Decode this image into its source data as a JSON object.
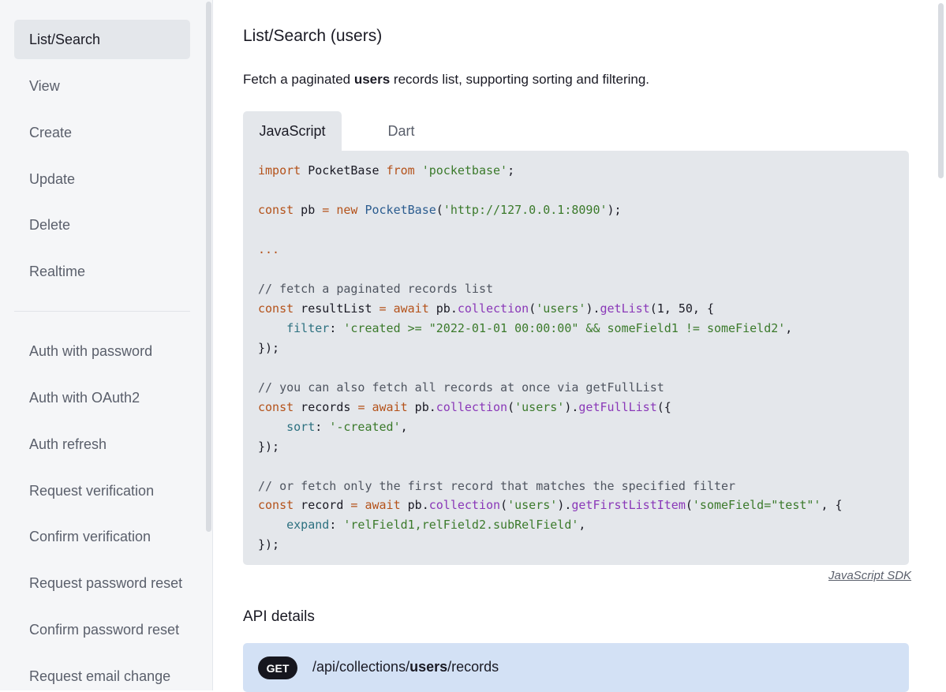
{
  "sidebar": {
    "items": [
      {
        "label": "List/Search",
        "active": true
      },
      {
        "label": "View"
      },
      {
        "label": "Create"
      },
      {
        "label": "Update"
      },
      {
        "label": "Delete"
      },
      {
        "label": "Realtime"
      },
      {
        "label": "Auth with password"
      },
      {
        "label": "Auth with OAuth2"
      },
      {
        "label": "Auth refresh"
      },
      {
        "label": "Request verification"
      },
      {
        "label": "Confirm verification"
      },
      {
        "label": "Request password reset"
      },
      {
        "label": "Confirm password reset"
      },
      {
        "label": "Request email change"
      }
    ]
  },
  "page": {
    "title": "List/Search (users)",
    "desc_prefix": "Fetch a paginated ",
    "desc_bold": "users",
    "desc_suffix": " records list, supporting sorting and filtering."
  },
  "tabs": [
    {
      "label": "JavaScript",
      "active": true
    },
    {
      "label": "Dart",
      "active": false
    }
  ],
  "code": {
    "l1_kw": "import",
    "l1_a": " PocketBase ",
    "l1_kw2": "from",
    "l1_sp": " ",
    "l1_str": "'pocketbase'",
    "l1_end": ";",
    "l2_kw": "const",
    "l2_a": " pb ",
    "l2_op": "=",
    "l2_sp": " ",
    "l2_kw2": "new",
    "l2_sp2": " ",
    "l2_cls": "PocketBase",
    "l2_p": "(",
    "l2_str": "'http://127.0.0.1:8090'",
    "l2_end": ");",
    "l3_dots": "...",
    "l4_cm": "// fetch a paginated records list",
    "l5_kw": "const",
    "l5_a": " resultList ",
    "l5_op": "=",
    "l5_sp": " ",
    "l5_kw2": "await",
    "l5_b": " pb.",
    "l5_fn": "collection",
    "l5_p": "(",
    "l5_str": "'users'",
    "l5_c": ").",
    "l5_fn2": "getList",
    "l5_d": "(1, ",
    "l5_num": "50",
    "l5_e": ", {",
    "l6_prop": "    filter",
    "l6_c": ": ",
    "l6_str": "'created >= \"2022-01-01 00:00:00\" && someField1 != someField2'",
    "l6_e": ",",
    "l7": "});",
    "l8_cm": "// you can also fetch all records at once via getFullList",
    "l9_kw": "const",
    "l9_a": " records ",
    "l9_op": "=",
    "l9_sp": " ",
    "l9_kw2": "await",
    "l9_b": " pb.",
    "l9_fn": "collection",
    "l9_p": "(",
    "l9_str": "'users'",
    "l9_c": ").",
    "l9_fn2": "getFullList",
    "l9_e": "({",
    "l10_prop": "    sort",
    "l10_c": ": ",
    "l10_str": "'-created'",
    "l10_e": ",",
    "l11": "});",
    "l12_cm": "// or fetch only the first record that matches the specified filter",
    "l13_kw": "const",
    "l13_a": " record ",
    "l13_op": "=",
    "l13_sp": " ",
    "l13_kw2": "await",
    "l13_b": " pb.",
    "l13_fn": "collection",
    "l13_p": "(",
    "l13_str": "'users'",
    "l13_c": ").",
    "l13_fn2": "getFirstListItem",
    "l13_p2": "(",
    "l13_str2": "'someField=\"test\"'",
    "l13_e": ", {",
    "l14_prop": "    expand",
    "l14_c": ": ",
    "l14_str": "'relField1,relField2.subRelField'",
    "l14_e": ",",
    "l15": "});"
  },
  "sdk_link": "JavaScript SDK",
  "api": {
    "heading": "API details",
    "method": "GET",
    "path_prefix": "/api/collections/",
    "path_bold": "users",
    "path_suffix": "/records"
  },
  "colors": {
    "sidebar_bg": "#f5f6f8",
    "active_bg": "#e4e7eb",
    "code_bg": "#e4e7eb",
    "api_box_bg": "#d3e1f5",
    "badge_bg": "#16161e"
  }
}
